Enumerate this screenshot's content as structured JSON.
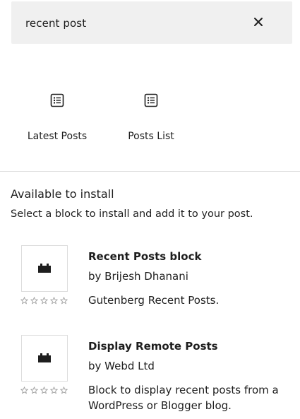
{
  "search": {
    "value": "recent post"
  },
  "block_results": [
    {
      "label": "Latest Posts",
      "icon": "post-list-icon"
    },
    {
      "label": "Posts List",
      "icon": "post-list-icon"
    }
  ],
  "install_section": {
    "title": "Available to install",
    "description": "Select a block to install and add it to your post."
  },
  "plugins": [
    {
      "title": "Recent Posts block",
      "author": "by Brijesh Dhanani",
      "description": "Gutenberg Recent Posts.",
      "icon": "block-default-icon",
      "rating": 0,
      "rating_max": 5
    },
    {
      "title": "Display Remote Posts",
      "author": "by Webd Ltd",
      "description": "Block to display recent posts from a WordPress or Blogger blog.",
      "icon": "block-default-icon",
      "rating": 0,
      "rating_max": 5
    }
  ]
}
